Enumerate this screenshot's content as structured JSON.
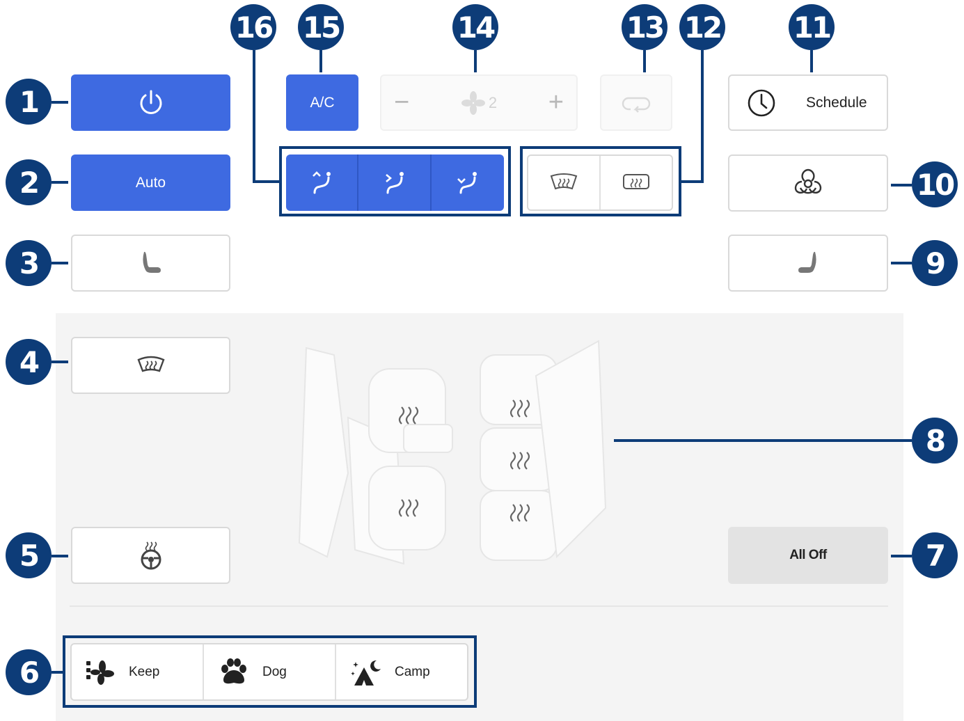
{
  "controls": {
    "ac_label": "A/C",
    "fan_speed": "2",
    "schedule_label": "Schedule",
    "auto_label": "Auto",
    "all_off_label": "All Off"
  },
  "modes": [
    {
      "label": "Keep",
      "icon": "keep-climate-icon"
    },
    {
      "label": "Dog",
      "icon": "dog-paw-icon"
    },
    {
      "label": "Camp",
      "icon": "camp-tent-icon"
    }
  ],
  "callouts": [
    "1",
    "2",
    "3",
    "4",
    "5",
    "6",
    "7",
    "8",
    "9",
    "10",
    "11",
    "12",
    "13",
    "14",
    "15",
    "16"
  ],
  "colors": {
    "accent": "#3e6ae1",
    "callout": "#0d3c78",
    "panel": "#f4f4f4"
  }
}
